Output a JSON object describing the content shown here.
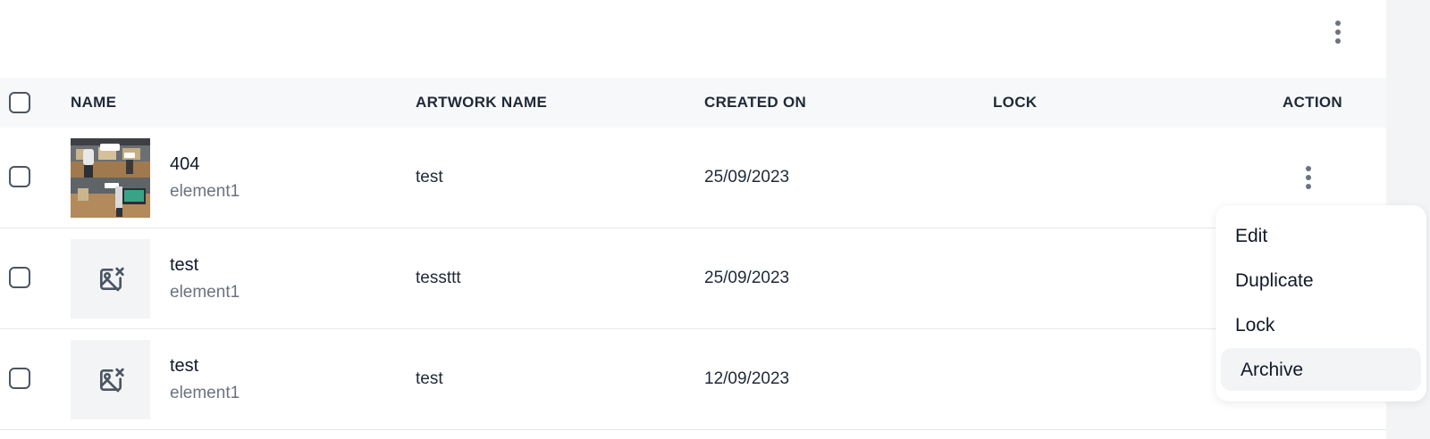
{
  "table": {
    "headers": {
      "name": "NAME",
      "artwork_name": "ARTWORK NAME",
      "created_on": "CREATED ON",
      "lock": "LOCK",
      "action": "ACTION"
    },
    "rows": [
      {
        "title": "404",
        "subtitle": "element1",
        "artwork_name": "test",
        "created_on": "25/09/2023",
        "lock": "",
        "thumbnail": "photo"
      },
      {
        "title": "test",
        "subtitle": "element1",
        "artwork_name": "tessttt",
        "created_on": "25/09/2023",
        "lock": "",
        "thumbnail": "image-off-icon"
      },
      {
        "title": "test",
        "subtitle": "element1",
        "artwork_name": "test",
        "created_on": "12/09/2023",
        "lock": "",
        "thumbnail": "image-off-icon"
      }
    ]
  },
  "action_menu": {
    "items": [
      "Edit",
      "Duplicate",
      "Lock",
      "Archive"
    ],
    "highlighted": "Archive"
  },
  "icons": {
    "more": "more-vertical-icon",
    "placeholder": "image-off-icon"
  },
  "colors": {
    "header_bg": "#f7f8fa",
    "icon_gray": "#6b7280",
    "subtext": "#6b7280",
    "hover_bg": "#f3f4f6"
  }
}
